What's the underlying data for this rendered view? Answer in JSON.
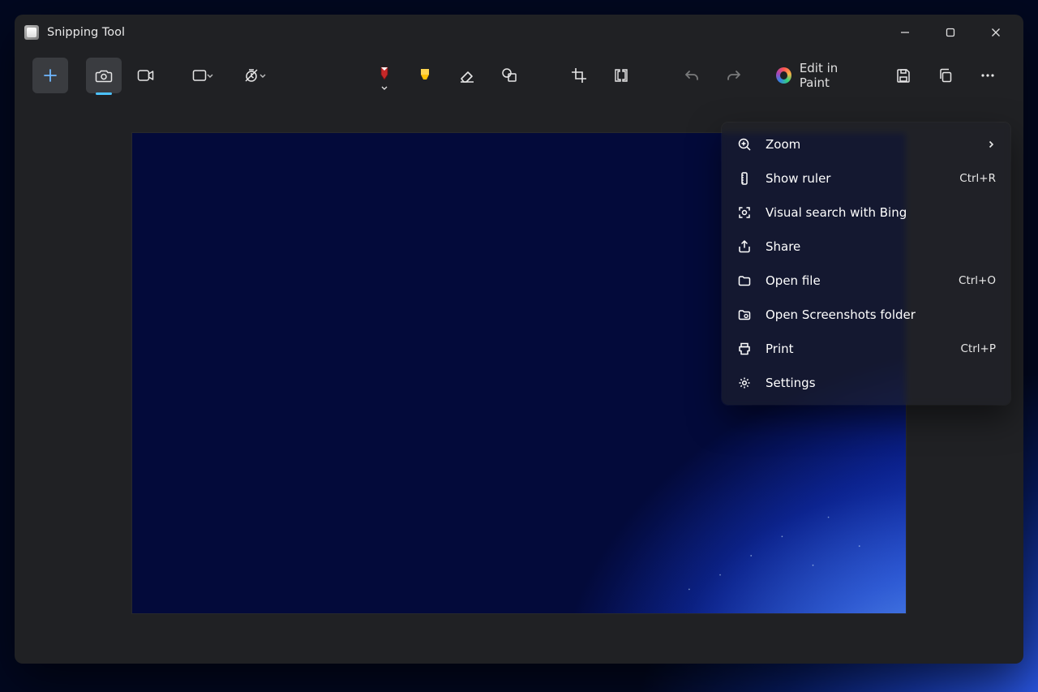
{
  "app": {
    "title": "Snipping Tool"
  },
  "toolbar": {
    "edit_in_paint_label": "Edit in Paint"
  },
  "menu": {
    "items": [
      {
        "icon": "zoom-icon",
        "label": "Zoom",
        "accel": "",
        "submenu": true
      },
      {
        "icon": "ruler-icon",
        "label": "Show ruler",
        "accel": "Ctrl+R",
        "submenu": false
      },
      {
        "icon": "visual-search-icon",
        "label": "Visual search with Bing",
        "accel": "",
        "submenu": false
      },
      {
        "icon": "share-icon",
        "label": "Share",
        "accel": "",
        "submenu": false
      },
      {
        "icon": "open-file-icon",
        "label": "Open file",
        "accel": "Ctrl+O",
        "submenu": false
      },
      {
        "icon": "folder-icon",
        "label": "Open Screenshots folder",
        "accel": "",
        "submenu": false
      },
      {
        "icon": "print-icon",
        "label": "Print",
        "accel": "Ctrl+P",
        "submenu": false
      },
      {
        "icon": "settings-icon",
        "label": "Settings",
        "accel": "",
        "submenu": false
      }
    ]
  }
}
